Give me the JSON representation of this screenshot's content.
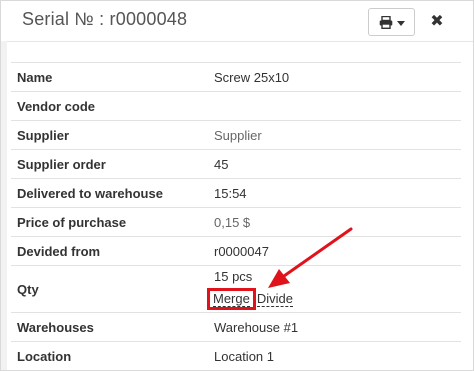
{
  "dialog": {
    "title": "Serial № : r0000048",
    "print_icon": "printer-icon",
    "close_label": "✖"
  },
  "details": {
    "rows": [
      {
        "label": "Name",
        "value": "Screw 25x10"
      },
      {
        "label": "Vendor code",
        "value": ""
      },
      {
        "label": "Supplier",
        "value": "Supplier"
      },
      {
        "label": "Supplier order",
        "value": "45"
      },
      {
        "label": "Delivered to warehouse",
        "value": "15:54"
      },
      {
        "label": "Price of purchase",
        "value": "0,15 $"
      },
      {
        "label": "Devided from",
        "value": "r0000047"
      }
    ],
    "qty": {
      "label": "Qty",
      "value": "15 pcs",
      "merge_label": "Merge",
      "divide_label": "Divide"
    },
    "warehouses": {
      "label": "Warehouses",
      "value": "Warehouse #1"
    },
    "location": {
      "label": "Location",
      "value": "Location 1"
    }
  },
  "colors": {
    "highlight": "#e0121b",
    "border": "#e2e2e2"
  }
}
